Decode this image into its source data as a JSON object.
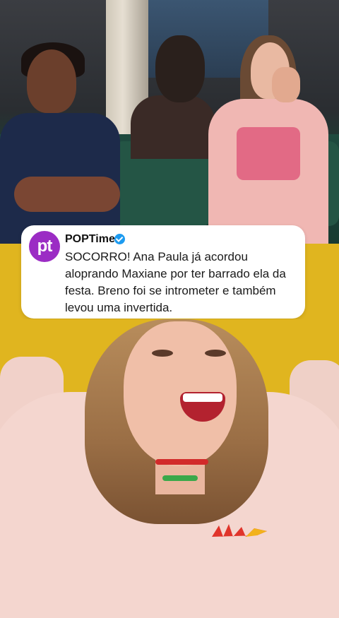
{
  "tweet": {
    "account_name": "POPTime",
    "avatar_text": "pt",
    "text": "SOCORRO! Ana Paula já acordou aloprando Maxiane por ter barrado ela da festa. Breno foi se intrometer e também levou uma invertida.",
    "verified": true
  },
  "colors": {
    "background_yellow": "#e0b51f",
    "avatar_purple": "#9b2cc4",
    "verified_blue": "#1d9bf0"
  },
  "icons": {
    "verified": "verified-badge-icon"
  }
}
